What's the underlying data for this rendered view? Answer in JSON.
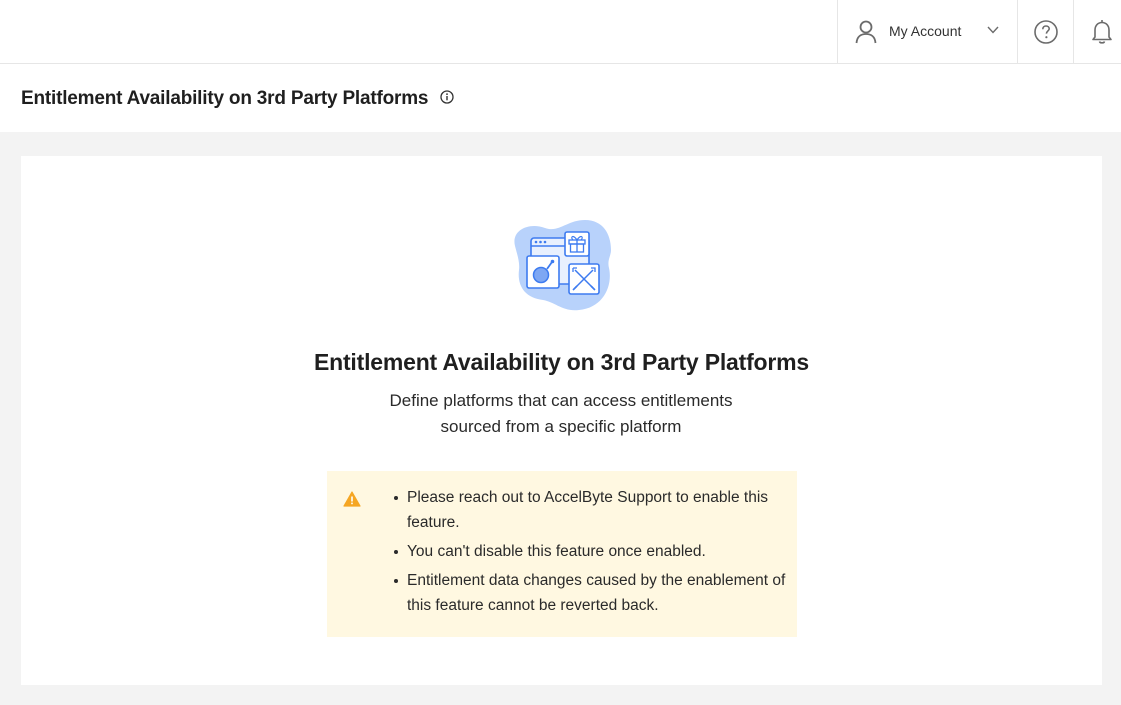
{
  "header": {
    "account_label": "My Account"
  },
  "page": {
    "title": "Entitlement Availability on 3rd Party Platforms"
  },
  "empty_state": {
    "title": "Entitlement Availability on 3rd Party Platforms",
    "description_line1": "Define platforms that can access entitlements",
    "description_line2": "sourced from a specific platform"
  },
  "notice": {
    "items": [
      "Please reach out to AccelByte Support to enable this feature.",
      "You can't disable this feature once enabled.",
      "Entitlement data changes caused by the enablement of this feature cannot be reverted back."
    ]
  },
  "colors": {
    "accent_blue": "#3d7bf0",
    "warning_bg": "#fff8e1",
    "warning_icon": "#f5a623"
  },
  "icons": [
    "user-icon",
    "chevron-down-icon",
    "help-icon",
    "bell-icon",
    "info-icon",
    "warning-icon"
  ]
}
